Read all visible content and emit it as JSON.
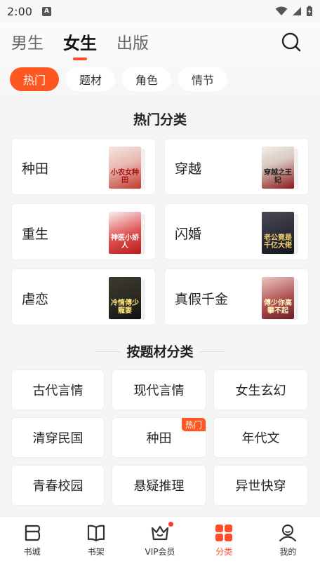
{
  "status_bar": {
    "time": "2:00",
    "notification_icon_letter": "A"
  },
  "top_tabs": [
    {
      "label": "男生",
      "active": false
    },
    {
      "label": "女生",
      "active": true
    },
    {
      "label": "出版",
      "active": false
    }
  ],
  "chips": [
    {
      "label": "热门",
      "active": true
    },
    {
      "label": "题材",
      "active": false
    },
    {
      "label": "角色",
      "active": false
    },
    {
      "label": "情节",
      "active": false
    }
  ],
  "hot_section": {
    "title": "热门分类",
    "items": [
      {
        "label": "种田",
        "cover_text": "小农女种田"
      },
      {
        "label": "穿越",
        "cover_text": "穿越之王妃"
      },
      {
        "label": "重生",
        "cover_text": "神医小娇人"
      },
      {
        "label": "闪婚",
        "cover_text": "老公竟是千亿大佬"
      },
      {
        "label": "虐恋",
        "cover_text": "冷情傅少寵妻"
      },
      {
        "label": "真假千金",
        "cover_text": "傅少你高攀不起"
      }
    ]
  },
  "category_section": {
    "title": "按题材分类",
    "hot_badge": "热门",
    "items": [
      {
        "label": "古代言情",
        "hot": false
      },
      {
        "label": "现代言情",
        "hot": false
      },
      {
        "label": "女生玄幻",
        "hot": false
      },
      {
        "label": "清穿民国",
        "hot": false
      },
      {
        "label": "种田",
        "hot": true
      },
      {
        "label": "年代文",
        "hot": false
      },
      {
        "label": "青春校园",
        "hot": false
      },
      {
        "label": "悬疑推理",
        "hot": false
      },
      {
        "label": "异世快穿",
        "hot": false
      }
    ]
  },
  "bottom_nav": [
    {
      "label": "书城",
      "icon": "bookstore-icon",
      "active": false
    },
    {
      "label": "书架",
      "icon": "bookshelf-icon",
      "active": false
    },
    {
      "label": "VIP会员",
      "icon": "vip-crown-icon",
      "active": false,
      "dot": true
    },
    {
      "label": "分类",
      "icon": "category-grid-icon",
      "active": true
    },
    {
      "label": "我的",
      "icon": "profile-icon",
      "active": false
    }
  ],
  "colors": {
    "accent": "#ff5722",
    "tab_underline": "#ff4d2a",
    "badge_dot": "#ff3b30"
  }
}
